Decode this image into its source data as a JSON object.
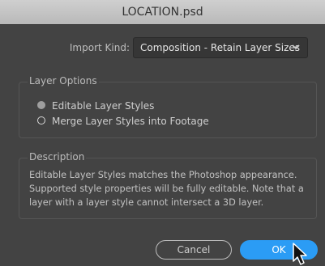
{
  "window": {
    "title": "LOCATION.psd"
  },
  "import": {
    "label": "Import Kind:",
    "selected": "Composition - Retain Layer Sizes"
  },
  "layer_options": {
    "title": "Layer Options",
    "options": [
      {
        "label": "Editable Layer Styles",
        "selected": true
      },
      {
        "label": "Merge Layer Styles into Footage",
        "selected": false
      }
    ]
  },
  "description": {
    "title": "Description",
    "text": "Editable Layer Styles matches the Photoshop appearance. Supported style properties will be fully editable. Note that a layer with a layer style cannot intersect a 3D layer."
  },
  "buttons": {
    "cancel": "Cancel",
    "ok": "OK"
  },
  "colors": {
    "accent": "#2b9cf5",
    "dialog_bg": "#434343",
    "titlebar_bg": "#c4c4c4"
  }
}
